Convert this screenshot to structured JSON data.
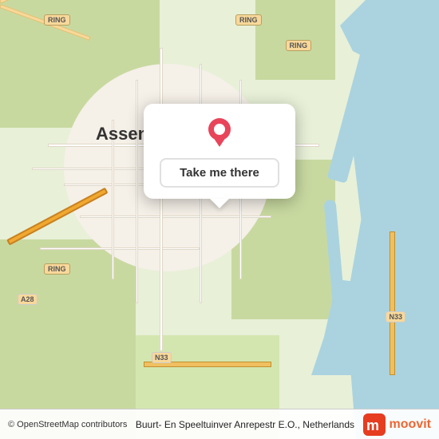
{
  "map": {
    "center_city": "Assen",
    "country": "Netherlands",
    "attribution": "© OpenStreetMap contributors",
    "popup": {
      "button_label": "Take me there"
    },
    "footer": {
      "location": "Buurt- En Speeltuinver Anrepestr E.O., Netherlands"
    },
    "labels": {
      "ring1": "RING",
      "ring2": "RING",
      "ring3": "RING",
      "ring4": "RING",
      "a28": "A28",
      "n33a": "N33",
      "n33b": "N33"
    },
    "moovit": "moovit"
  }
}
